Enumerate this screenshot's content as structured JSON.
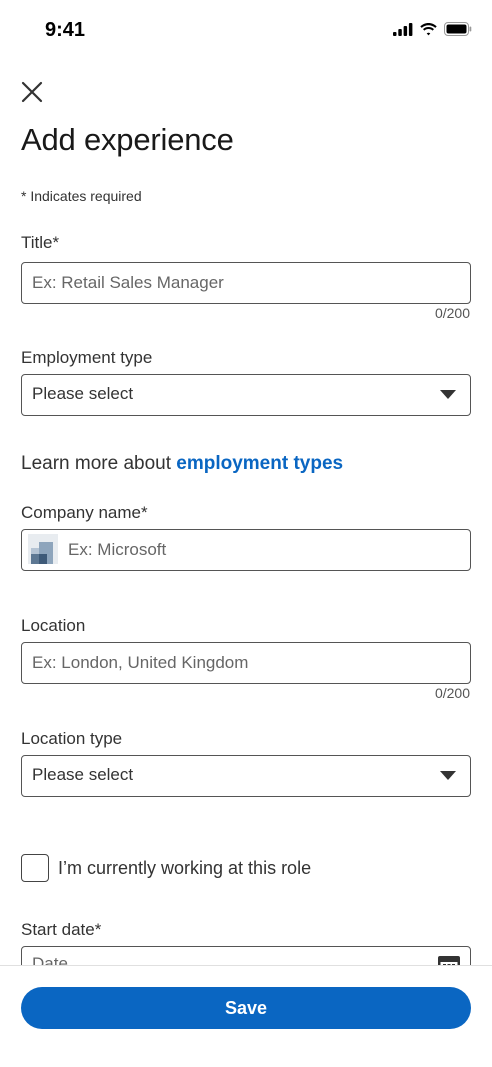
{
  "status_bar": {
    "time": "9:41",
    "icons": [
      "signal-icon",
      "wifi-icon",
      "battery-icon"
    ]
  },
  "header": {
    "close_icon": "close-icon",
    "title": "Add experience",
    "required_note": "* Indicates required"
  },
  "form": {
    "title": {
      "label": "Title*",
      "placeholder": "Ex: Retail Sales Manager",
      "counter": "0/200"
    },
    "employment_type": {
      "label": "Employment type",
      "value": "Please select"
    },
    "learn_more": {
      "prefix": "Learn more about ",
      "link": "employment types"
    },
    "company": {
      "label": "Company name*",
      "placeholder": "Ex: Microsoft"
    },
    "location": {
      "label": "Location",
      "placeholder": "Ex: London, United Kingdom",
      "counter": "0/200"
    },
    "location_type": {
      "label": "Location type",
      "value": "Please select"
    },
    "currently_working": {
      "label": "I’m currently working at this role",
      "checked": false
    },
    "start_date": {
      "label": "Start date*",
      "placeholder": "Date"
    }
  },
  "footer": {
    "save_label": "Save"
  },
  "colors": {
    "accent": "#0a66c2",
    "text": "#191919",
    "border": "#555555"
  }
}
